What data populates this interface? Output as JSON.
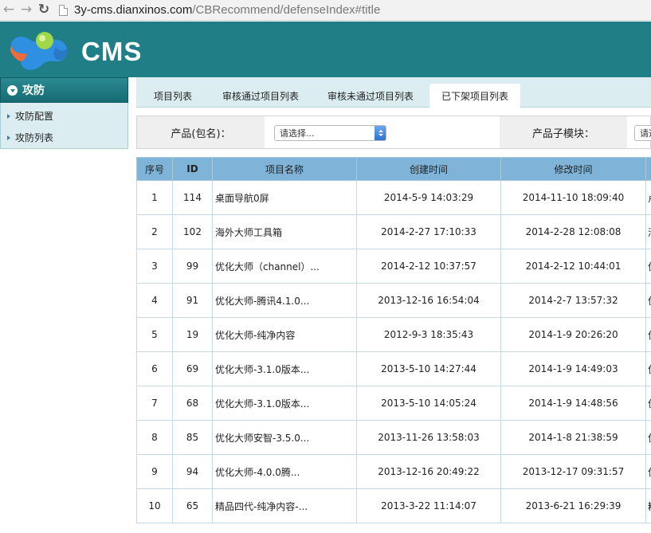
{
  "browser": {
    "url_host": "3y-cms.dianxinos.com",
    "url_path": "/CBRecommend/defenseIndex#title"
  },
  "header": {
    "logo_text": "CMS",
    "colors": {
      "header_bg": "#1f7e86",
      "logo_blue": "#2f8fe0",
      "logo_orange": "#f06a3a",
      "logo_green": "#9fd84a"
    }
  },
  "sidebar": {
    "title": "攻防",
    "items": [
      {
        "label": "攻防配置"
      },
      {
        "label": "攻防列表"
      }
    ]
  },
  "tabs": [
    {
      "label": "项目列表",
      "active": false
    },
    {
      "label": "审核通过项目列表",
      "active": false
    },
    {
      "label": "审核未通过项目列表",
      "active": false
    },
    {
      "label": "已下架项目列表",
      "active": true
    }
  ],
  "filters": {
    "product_label": "产品(包名)：",
    "product_placeholder": "请选择...",
    "module_label": "产品子模块：",
    "module_placeholder": "请选"
  },
  "table": {
    "columns": [
      "序号",
      "ID",
      "项目名称",
      "创建时间",
      "修改时间"
    ],
    "rows": [
      {
        "no": "1",
        "id": "114",
        "name": "桌面导航0屏",
        "created": "2014-5-9 14:03:29",
        "modified": "2014-11-10 18:09:40",
        "extra": "卢"
      },
      {
        "no": "2",
        "id": "102",
        "name": "海外大师工具箱",
        "created": "2014-2-27 17:10:33",
        "modified": "2014-2-28 12:08:08",
        "extra": "淮"
      },
      {
        "no": "3",
        "id": "99",
        "name": "优化大师（channel）...",
        "created": "2014-2-12 10:37:57",
        "modified": "2014-2-12 10:44:01",
        "extra": "优"
      },
      {
        "no": "4",
        "id": "91",
        "name": "优化大师-腾讯4.1.0...",
        "created": "2013-12-16 16:54:04",
        "modified": "2014-2-7 13:57:32",
        "extra": "优"
      },
      {
        "no": "5",
        "id": "19",
        "name": "优化大师-纯净内容",
        "created": "2012-9-3 18:35:43",
        "modified": "2014-1-9 20:26:20",
        "extra": "优"
      },
      {
        "no": "6",
        "id": "69",
        "name": "优化大师-3.1.0版本...",
        "created": "2013-5-10 14:27:44",
        "modified": "2014-1-9 14:49:03",
        "extra": "优"
      },
      {
        "no": "7",
        "id": "68",
        "name": "优化大师-3.1.0版本...",
        "created": "2013-5-10 14:05:24",
        "modified": "2014-1-9 14:48:56",
        "extra": "优"
      },
      {
        "no": "8",
        "id": "85",
        "name": "优化大师安智-3.5.0...",
        "created": "2013-11-26 13:58:03",
        "modified": "2014-1-8 21:38:59",
        "extra": "优"
      },
      {
        "no": "9",
        "id": "94",
        "name": "优化大师-4.0.0腾...",
        "created": "2013-12-16 20:49:22",
        "modified": "2013-12-17 09:31:57",
        "extra": "优"
      },
      {
        "no": "10",
        "id": "65",
        "name": "精品四代-纯净内容-...",
        "created": "2013-3-22 11:14:07",
        "modified": "2013-6-21 16:29:39",
        "extra": "精"
      }
    ]
  }
}
